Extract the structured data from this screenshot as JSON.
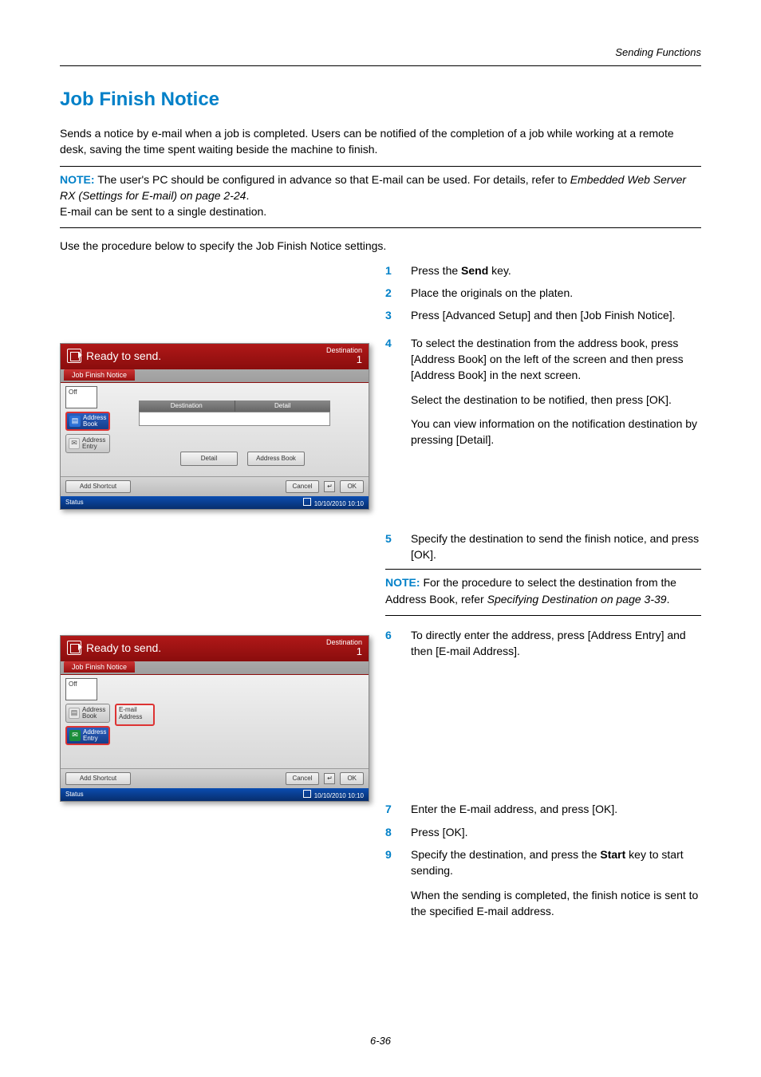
{
  "header": {
    "section_title": "Sending Functions"
  },
  "title": "Job Finish Notice",
  "intro": "Sends a notice by e-mail when a job is completed. Users can be notified of the completion of a job while working at a remote desk, saving the time spent waiting beside the machine to finish.",
  "note1": {
    "label": "NOTE:",
    "line1a": " The user's PC should be configured in advance so that E-mail can be used. For details, refer to ",
    "line1b": "Embedded Web Server RX (Settings for E-mail) on page 2-24",
    "line1c": ".",
    "line2": "E-mail can be sent to a single destination."
  },
  "lead": "Use the procedure below to specify the Job Finish Notice settings.",
  "steps": {
    "s1": "Press the Send key.",
    "s1_pre": "Press the ",
    "s1_b": "Send",
    "s1_post": " key.",
    "s2": "Place the originals on the platen.",
    "s3": "Press [Advanced Setup] and then [Job Finish Notice].",
    "s4a": "To select the destination from the address book, press [Address Book] on the left of the screen and then press [Address Book] in the next screen.",
    "s4b": "Select the destination to be notified, then press [OK].",
    "s4c": "You can view information on the notification destination by pressing [Detail].",
    "s5": "Specify the destination to send the finish notice, and press [OK].",
    "s6": "To directly enter the address, press [Address Entry] and then [E-mail Address].",
    "s7": "Enter the E-mail address, and press [OK].",
    "s8": "Press [OK].",
    "s9_pre": "Specify the destination, and press the ",
    "s9_b": "Start",
    "s9_post": " key to start sending.",
    "s9b": "When the sending is completed, the finish notice is sent to the specified E-mail address."
  },
  "note2": {
    "label": "NOTE:",
    "text": " For the procedure to select the destination from the Address Book, refer ",
    "italic": "Specifying Destination on page 3-39",
    "tail": "."
  },
  "panel": {
    "title": "Ready to send.",
    "dest_label": "Destination",
    "dest_count": "1",
    "tab": "Job Finish Notice",
    "off": "Off",
    "addr_book": "Address\nBook",
    "addr_entry": "Address\nEntry",
    "col_dest": "Destination",
    "col_detail": "Detail",
    "btn_detail": "Detail",
    "btn_addrbook": "Address Book",
    "email_addr": "E-mail\nAddress",
    "add_shortcut": "Add Shortcut",
    "cancel": "Cancel",
    "ok": "OK",
    "return": "↵",
    "status": "Status",
    "datetime": "10/10/2010  10:10"
  },
  "page_num": "6-36"
}
